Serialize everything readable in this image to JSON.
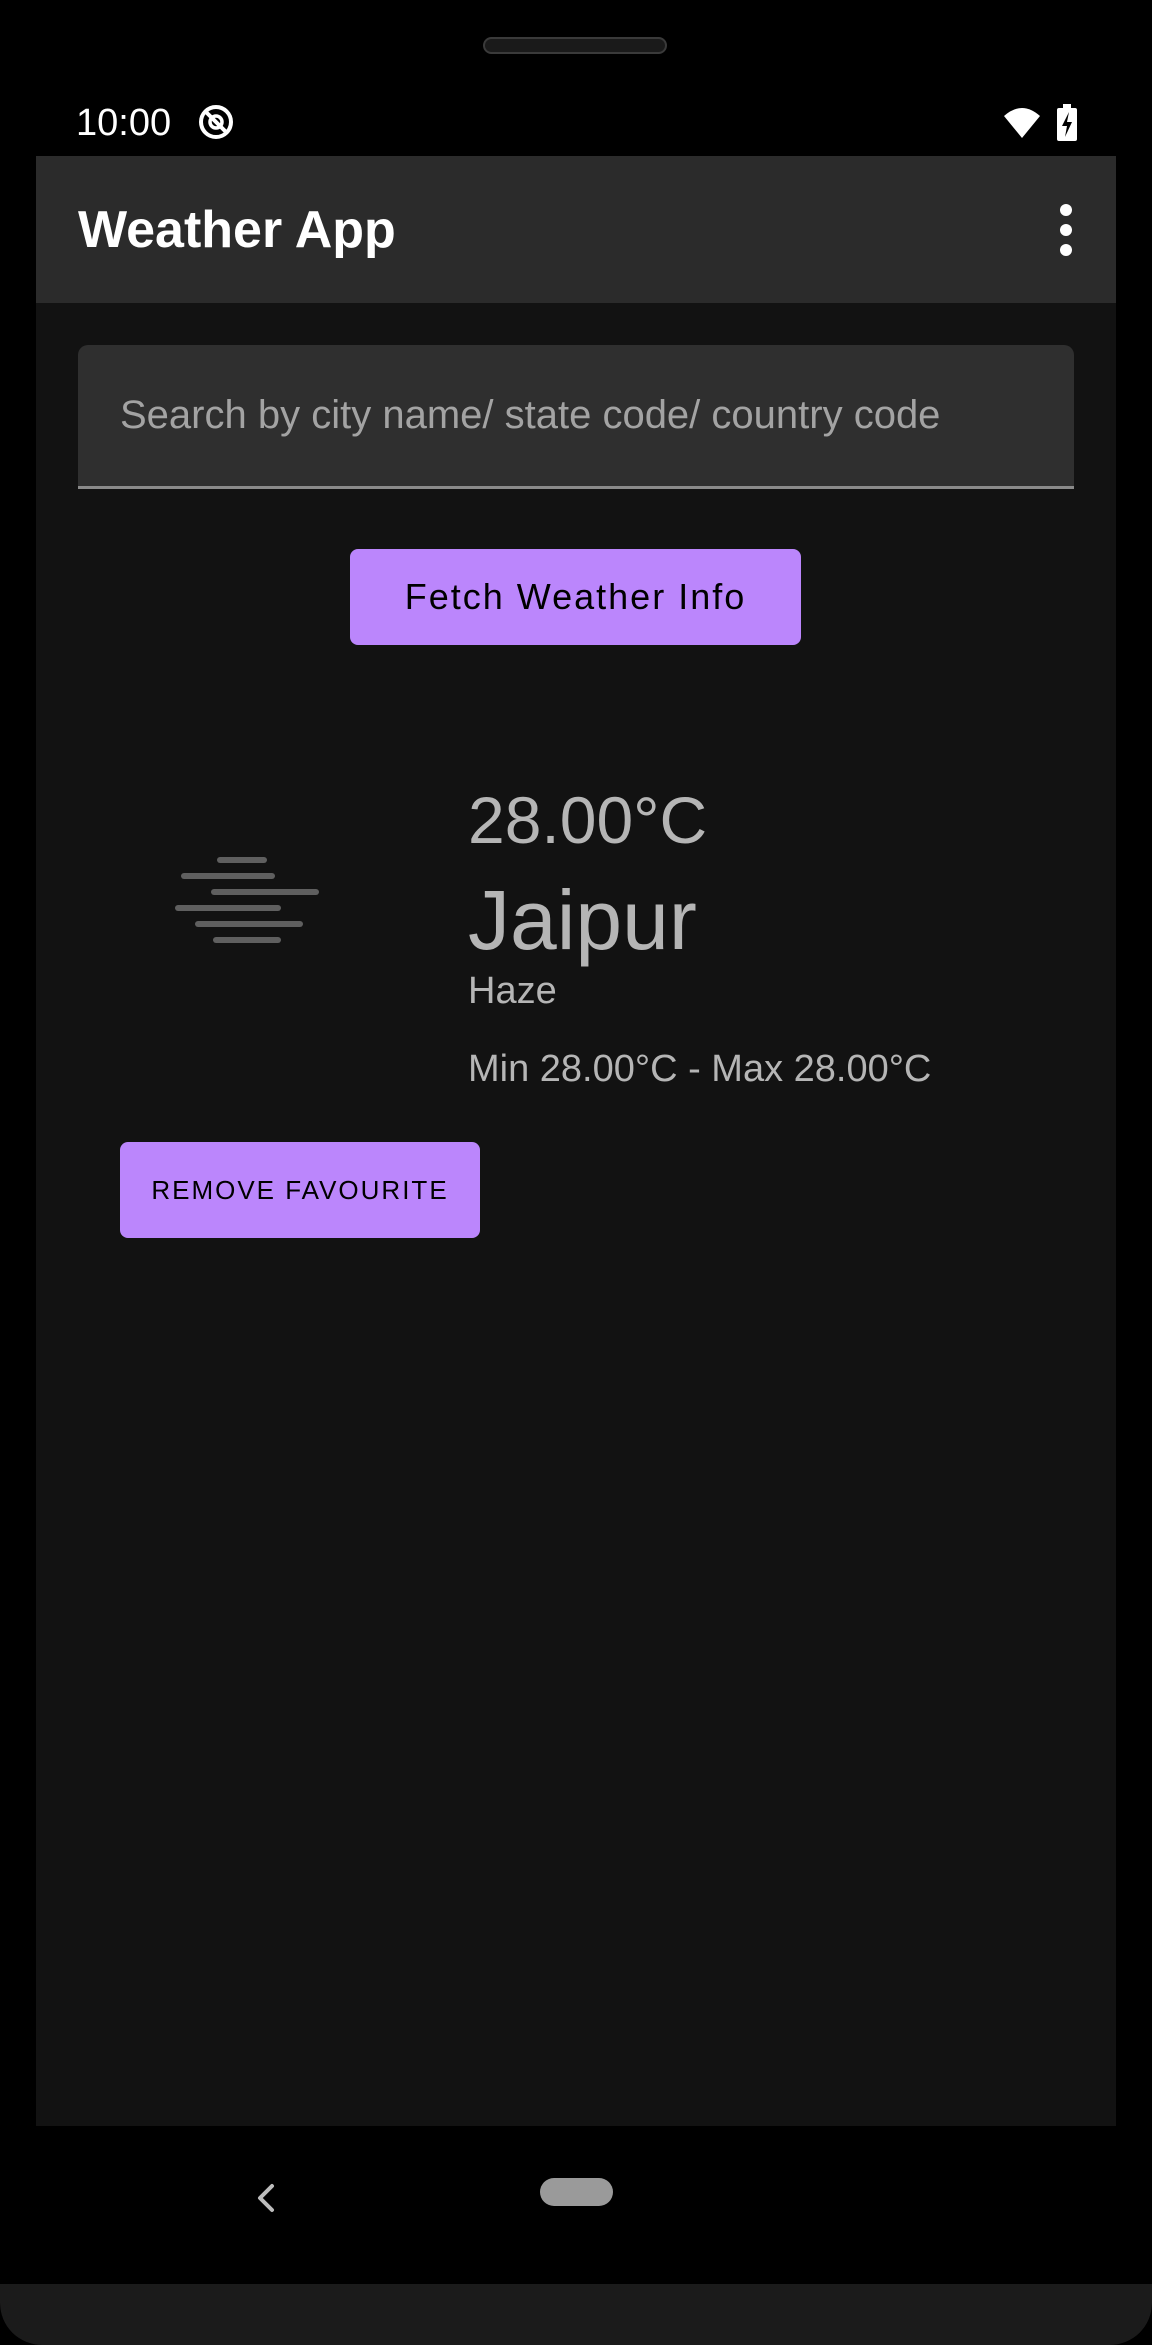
{
  "status_bar": {
    "time": "10:00",
    "icons": [
      "do-not-disturb-icon",
      "wifi-icon",
      "battery-charging-icon"
    ]
  },
  "app_bar": {
    "title": "Weather App",
    "menu_icon": "more-vert-icon"
  },
  "search": {
    "placeholder": "Search by city name/ state code/ country code",
    "value": ""
  },
  "actions": {
    "fetch_label": "Fetch Weather Info"
  },
  "weather": {
    "icon": "haze-icon",
    "temperature": "28.00°C",
    "city": "Jaipur",
    "condition": "Haze",
    "min_max": "Min 28.00°C - Max 28.00°C",
    "remove_label": "REMOVE FAVOURITE"
  },
  "navigation": {
    "back_icon": "back-icon",
    "home_icon": "home-pill-icon"
  },
  "colors": {
    "accent": "#bb86fc",
    "background": "#121212",
    "app_bar": "#2b2b2b",
    "text_primary": "#ffffff",
    "text_secondary": "#b5b5b5"
  }
}
